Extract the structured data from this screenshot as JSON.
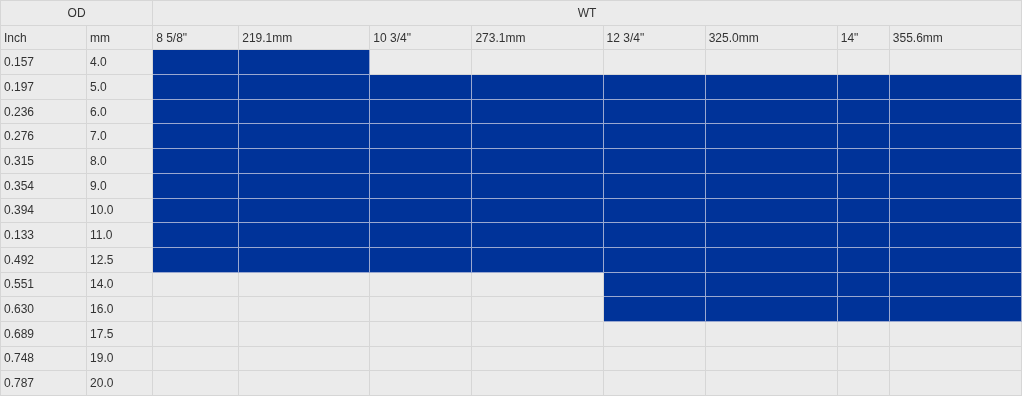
{
  "table": {
    "od_heading": "OD",
    "wt_heading": "WT",
    "od_columns": [
      "Inch",
      "mm"
    ],
    "sizes": [
      {
        "inch": "8 5/8\"",
        "mm": "219.1mm"
      },
      {
        "inch": "10 3/4\"",
        "mm": "273.1mm"
      },
      {
        "inch": "12 3/4\"",
        "mm": "325.0mm"
      },
      {
        "inch": "14\"",
        "mm": "355.6mm"
      }
    ],
    "rows": [
      {
        "inch": "0.157",
        "mm": "4.0",
        "available": [
          true,
          false,
          false,
          false
        ]
      },
      {
        "inch": "0.197",
        "mm": "5.0",
        "available": [
          true,
          true,
          true,
          true
        ]
      },
      {
        "inch": "0.236",
        "mm": "6.0",
        "available": [
          true,
          true,
          true,
          true
        ]
      },
      {
        "inch": "0.276",
        "mm": "7.0",
        "available": [
          true,
          true,
          true,
          true
        ]
      },
      {
        "inch": "0.315",
        "mm": "8.0",
        "available": [
          true,
          true,
          true,
          true
        ]
      },
      {
        "inch": "0.354",
        "mm": "9.0",
        "available": [
          true,
          true,
          true,
          true
        ]
      },
      {
        "inch": "0.394",
        "mm": "10.0",
        "available": [
          true,
          true,
          true,
          true
        ]
      },
      {
        "inch": "0.133",
        "mm": "11.0",
        "available": [
          true,
          true,
          true,
          true
        ]
      },
      {
        "inch": "0.492",
        "mm": "12.5",
        "available": [
          true,
          true,
          true,
          true
        ]
      },
      {
        "inch": "0.551",
        "mm": "14.0",
        "available": [
          false,
          false,
          true,
          true
        ]
      },
      {
        "inch": "0.630",
        "mm": "16.0",
        "available": [
          false,
          false,
          true,
          true
        ]
      },
      {
        "inch": "0.689",
        "mm": "17.5",
        "available": [
          false,
          false,
          false,
          false
        ]
      },
      {
        "inch": "0.748",
        "mm": "19.0",
        "available": [
          false,
          false,
          false,
          false
        ]
      },
      {
        "inch": "0.787",
        "mm": "20.0",
        "available": [
          false,
          false,
          false,
          false
        ]
      }
    ]
  }
}
